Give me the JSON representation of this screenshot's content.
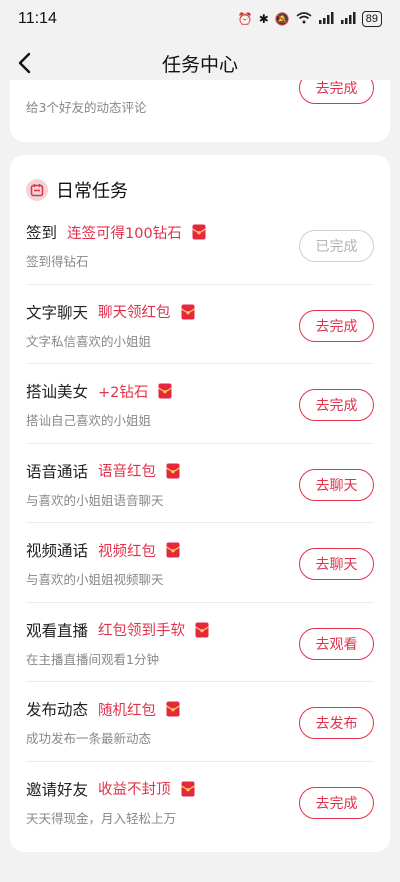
{
  "status_bar": {
    "time": "11:14",
    "battery": "89"
  },
  "nav": {
    "title": "任务中心"
  },
  "prev_card": {
    "desc": "给3个好友的动态评论",
    "button": "去完成"
  },
  "daily": {
    "title": "日常任务",
    "tasks": [
      {
        "title": "签到",
        "reward": "连签可得100钻石",
        "desc": "签到得钻石",
        "button": "已完成",
        "done": true
      },
      {
        "title": "文字聊天",
        "reward": "聊天领红包",
        "desc": "文字私信喜欢的小姐姐",
        "button": "去完成",
        "done": false
      },
      {
        "title": "搭讪美女",
        "reward": "+2钻石",
        "desc": "搭讪自己喜欢的小姐姐",
        "button": "去完成",
        "done": false
      },
      {
        "title": "语音通话",
        "reward": "语音红包",
        "desc": "与喜欢的小姐姐语音聊天",
        "button": "去聊天",
        "done": false
      },
      {
        "title": "视频通话",
        "reward": "视频红包",
        "desc": "与喜欢的小姐姐视频聊天",
        "button": "去聊天",
        "done": false
      },
      {
        "title": "观看直播",
        "reward": "红包领到手软",
        "desc": "在主播直播间观看1分钟",
        "button": "去观看",
        "done": false
      },
      {
        "title": "发布动态",
        "reward": "随机红包",
        "desc": "成功发布一条最新动态",
        "button": "去发布",
        "done": false
      },
      {
        "title": "邀请好友",
        "reward": "收益不封顶",
        "desc": "天天得现金，月入轻松上万",
        "button": "去完成",
        "done": false
      }
    ]
  },
  "colors": {
    "accent": "#e0334b",
    "background": "#f2f2f2"
  },
  "icons": {
    "back": "chevron-left-icon",
    "section": "calendar-icon",
    "reward": "red-envelope-icon"
  }
}
